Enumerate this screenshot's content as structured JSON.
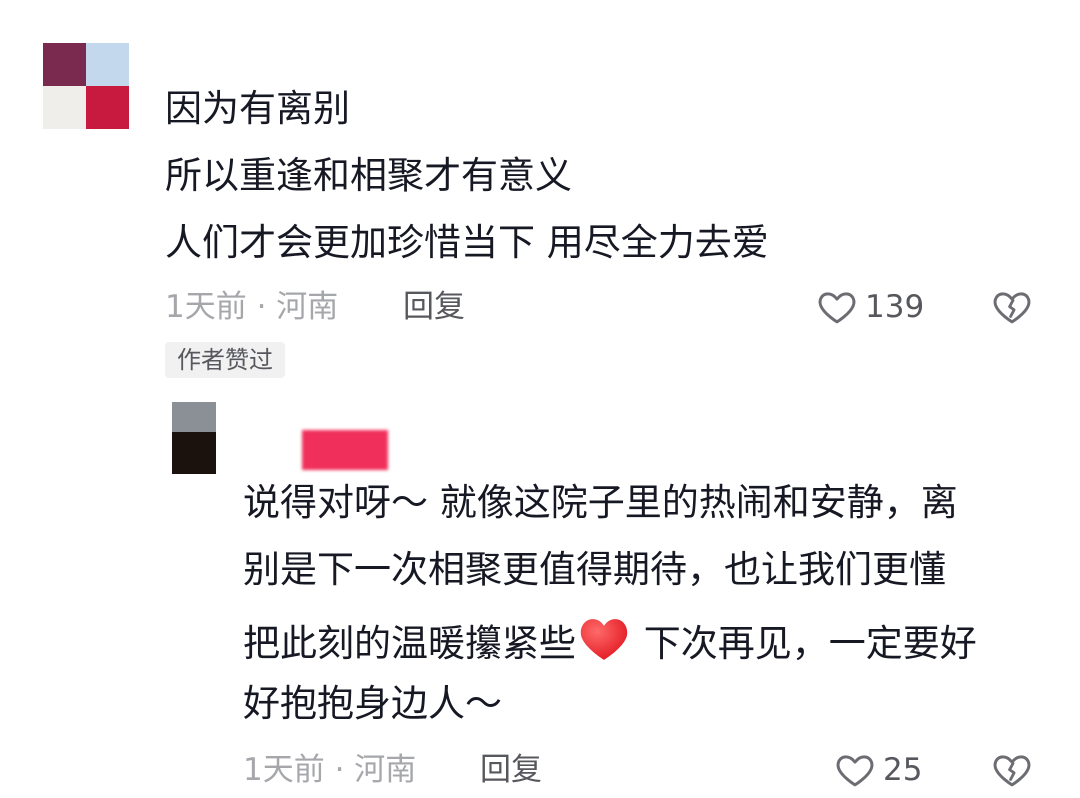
{
  "comment": {
    "lines": [
      "因为有离别",
      "所以重逢和相聚才有意义",
      "人们才会更加珍惜当下  用尽全力去爱"
    ],
    "meta": "1天前 · 河南",
    "reply_label": "回复",
    "like_count": "139",
    "badge": "作者赞过",
    "avatar_colors": [
      "#7a2a4e",
      "#c3d8ec",
      "#efeeea",
      "#c8193f"
    ]
  },
  "reply": {
    "lines": [
      "说得对呀～ 就像这院子里的热闹和安静，离",
      "别是下一次相聚更值得期待，也让我们更懂",
      "把此刻的温暖攥紧些",
      " 下次再见，一定要好",
      "好抱抱身边人～"
    ],
    "meta": "1天前 · 河南",
    "reply_label": "回复",
    "like_count": "25",
    "name_redaction_color": "#f0305a",
    "avatar_colors": [
      "#8b9097",
      "#1b110d"
    ]
  },
  "icons": {
    "like": "heart-outline-icon",
    "dislike": "broken-heart-icon",
    "emoji": "red-heart-emoji"
  }
}
